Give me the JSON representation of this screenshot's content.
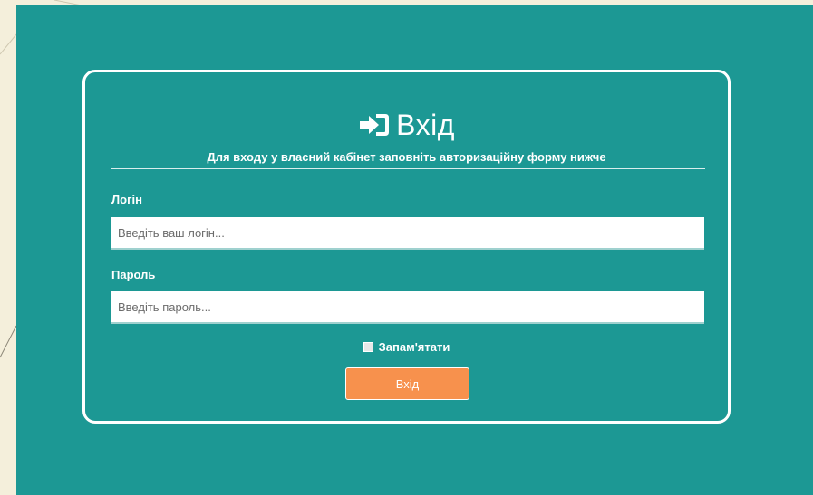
{
  "login_form": {
    "title": "Вхід",
    "title_icon": "sign-in-icon",
    "subtitle": "Для входу у власний кабінет заповніть авторизаційну форму нижче",
    "login_label": "Логін",
    "login_value": "",
    "login_placeholder": "Введіть ваш логін...",
    "password_label": "Пароль",
    "password_value": "",
    "password_placeholder": "Введіть пароль...",
    "remember_label": "Запам'ятати",
    "remember_checked": false,
    "submit_label": "Вхід"
  },
  "colors": {
    "background": "#1c9894",
    "outer_background": "#f4efdb",
    "button": "#f7914d",
    "text": "#ffffff"
  }
}
